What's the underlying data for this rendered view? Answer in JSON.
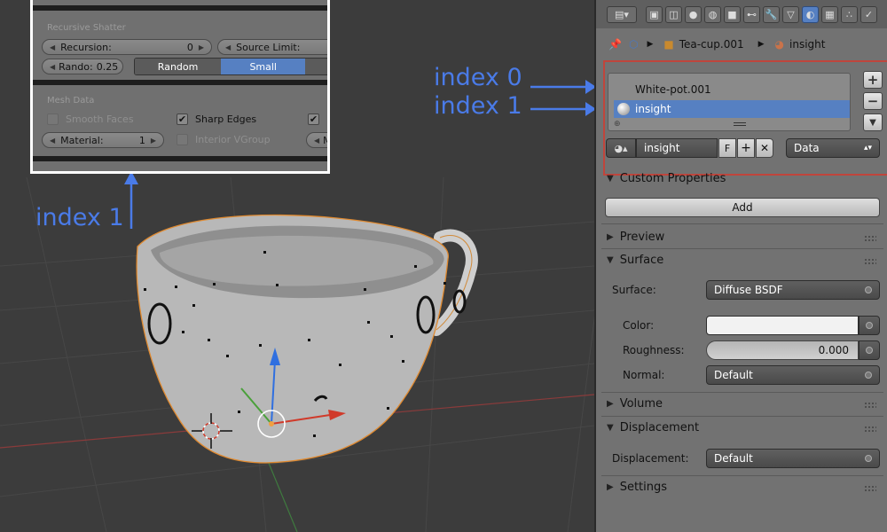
{
  "annotations": {
    "index0": "index 0",
    "index1_right": "index 1",
    "index1_left": "index 1"
  },
  "inset": {
    "section1_title": "Recursive Shatter",
    "recursion_label": "Recursion:",
    "recursion_value": "0",
    "source_limit_label": "Source Limit:",
    "rando_label": "Rando:",
    "rando_value": "0.25",
    "random_label": "Random",
    "small_label": "Small",
    "section2_title": "Mesh Data",
    "smooth_faces_label": "Smooth Faces",
    "sharp_edges_label": "Sharp Edges",
    "material_label": "Material:",
    "material_value": "1",
    "interior_vgroup_label": "Interior VGroup",
    "m_label": "M"
  },
  "breadcrumb": {
    "object": "Tea-cup.001",
    "material": "insight"
  },
  "material_slots": [
    "White-pot.001",
    "insight"
  ],
  "material_selector": {
    "name": "insight",
    "fake_user": "F",
    "link": "Data"
  },
  "custom_properties": {
    "title": "Custom Properties",
    "add_label": "Add"
  },
  "preview": {
    "title": "Preview"
  },
  "surface": {
    "title": "Surface",
    "surface_label": "Surface:",
    "surface_value": "Diffuse BSDF",
    "color_label": "Color:",
    "color_value": "#f2f2f2",
    "roughness_label": "Roughness:",
    "roughness_value": "0.000",
    "normal_label": "Normal:",
    "normal_value": "Default"
  },
  "volume": {
    "title": "Volume"
  },
  "displacement": {
    "title": "Displacement",
    "label": "Displacement:",
    "value": "Default"
  },
  "settings": {
    "title": "Settings"
  },
  "colors": {
    "accent": "#5680c2",
    "annotation": "#4a7be8",
    "highlight_border": "#c0453c"
  }
}
